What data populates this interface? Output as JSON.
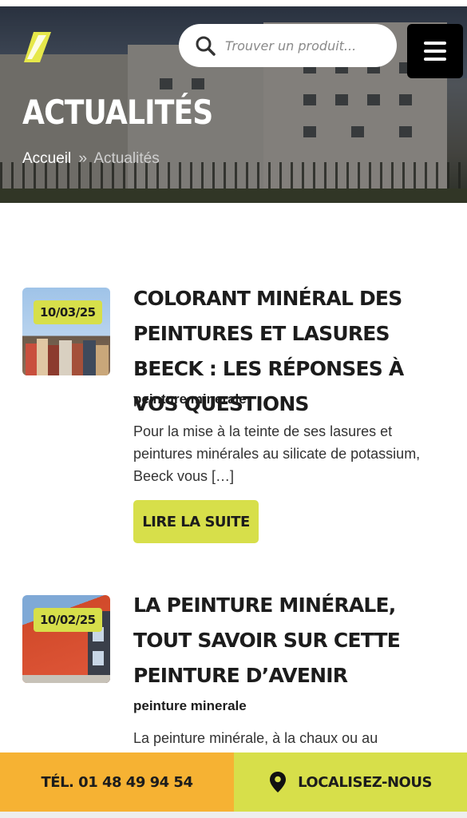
{
  "header": {
    "logo_alt": "logo",
    "search": {
      "placeholder": "Trouver un produit..."
    },
    "menu_icon": "hamburger-menu-icon"
  },
  "hero": {
    "title": "ACTUALITÉS",
    "breadcrumb": {
      "home": "Accueil",
      "separator": "»",
      "current": "Actualités"
    }
  },
  "articles": [
    {
      "date": "10/03/25",
      "title": "COLORANT MINÉRAL DES PEINTURES ET LASURES BEECK : LES RÉPONSES À VOS QUESTIONS",
      "category": "peinture minerale",
      "excerpt": "Pour la mise à la teinte de ses lasures et peintures minérales au silicate de potassium, Beeck vous […]",
      "cta": "LIRE LA SUITE"
    },
    {
      "date": "10/02/25",
      "title": "LA PEINTURE MINÉRALE, TOUT SAVOIR SUR CETTE PEINTURE D’AVENIR",
      "category": "peinture minerale",
      "excerpt": "La peinture minérale, à la chaux ou au"
    }
  ],
  "bottom_bar": {
    "phone": "TÉL. 01 48 49 94 54",
    "locate": "LOCALISEZ-NOUS"
  },
  "colors": {
    "accent_yellow": "#d7df4a",
    "accent_orange": "#f6b233"
  }
}
